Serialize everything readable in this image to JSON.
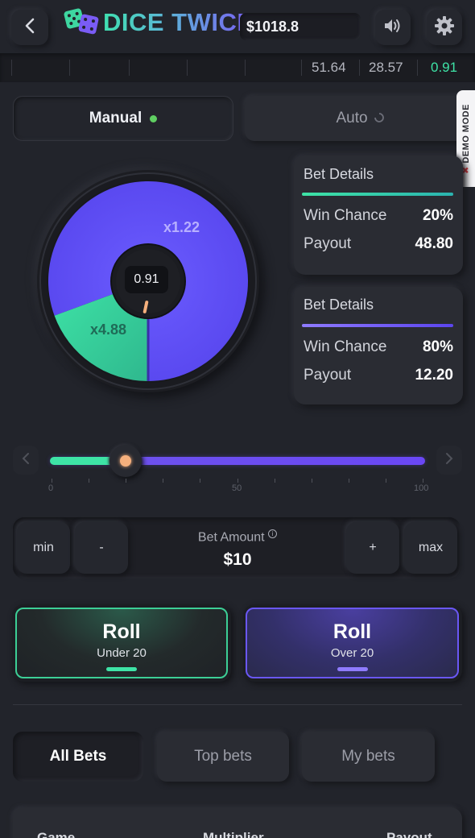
{
  "header": {
    "logo_text": "DICE TWICE",
    "balance": "$1018.8"
  },
  "history": {
    "values": [
      {
        "value": "51.64",
        "color": "#b5b7c0"
      },
      {
        "value": "28.57",
        "color": "#b5b7c0"
      },
      {
        "value": "0.91",
        "color": "#3ee3a6"
      }
    ]
  },
  "mode_tabs": {
    "manual": "Manual",
    "auto": "Auto"
  },
  "demo_badge": "DEMO MODE",
  "wheel": {
    "center_value": "0.91",
    "big_segment_label": "x1.22",
    "small_segment_label": "x4.88",
    "purple_color": "#6a57f5",
    "green_color": "#3ed6a0",
    "green_fraction": 0.2
  },
  "bet_details": [
    {
      "title": "Bet Details",
      "win_chance_label": "Win Chance",
      "win_chance": "20%",
      "payout_label": "Payout",
      "payout": "48.80",
      "accent": "#3ee3a6"
    },
    {
      "title": "Bet Details",
      "win_chance_label": "Win Chance",
      "win_chance": "80%",
      "payout_label": "Payout",
      "payout": "12.20",
      "accent": "#7b61f6"
    }
  ],
  "slider": {
    "value": 20,
    "scale_labels": [
      "0",
      "50",
      "100"
    ]
  },
  "bet_amount": {
    "label": "Bet Amount",
    "value": "$10",
    "min_label": "min",
    "minus_label": "-",
    "plus_label": "+",
    "max_label": "max"
  },
  "roll_under": {
    "title": "Roll",
    "subtitle": "Under 20"
  },
  "roll_over": {
    "title": "Roll",
    "subtitle": "Over 20"
  },
  "bets_tabs": {
    "all": "All Bets",
    "top": "Top bets",
    "mine": "My bets"
  },
  "bets_table": {
    "columns": [
      "Game",
      "Multiplier",
      "Payout"
    ]
  }
}
